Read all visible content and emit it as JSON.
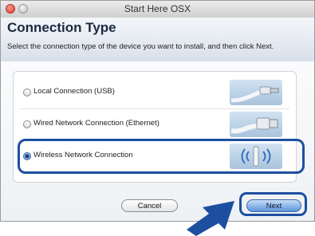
{
  "window": {
    "title": "Start Here OSX"
  },
  "header": {
    "title": "Connection Type",
    "instruction": "Select the connection type of the device you want to install, and then click Next."
  },
  "options": [
    {
      "label": "Local Connection (USB)",
      "selected": false,
      "icon": "usb-cable-icon"
    },
    {
      "label": "Wired Network Connection (Ethernet)",
      "selected": false,
      "icon": "ethernet-cable-icon"
    },
    {
      "label": "Wireless Network Connection",
      "selected": true,
      "icon": "wireless-signal-icon"
    }
  ],
  "buttons": {
    "cancel": "Cancel",
    "next": "Next"
  },
  "colors": {
    "highlight": "#1d4fa0",
    "arrow": "#1d4fa0"
  }
}
